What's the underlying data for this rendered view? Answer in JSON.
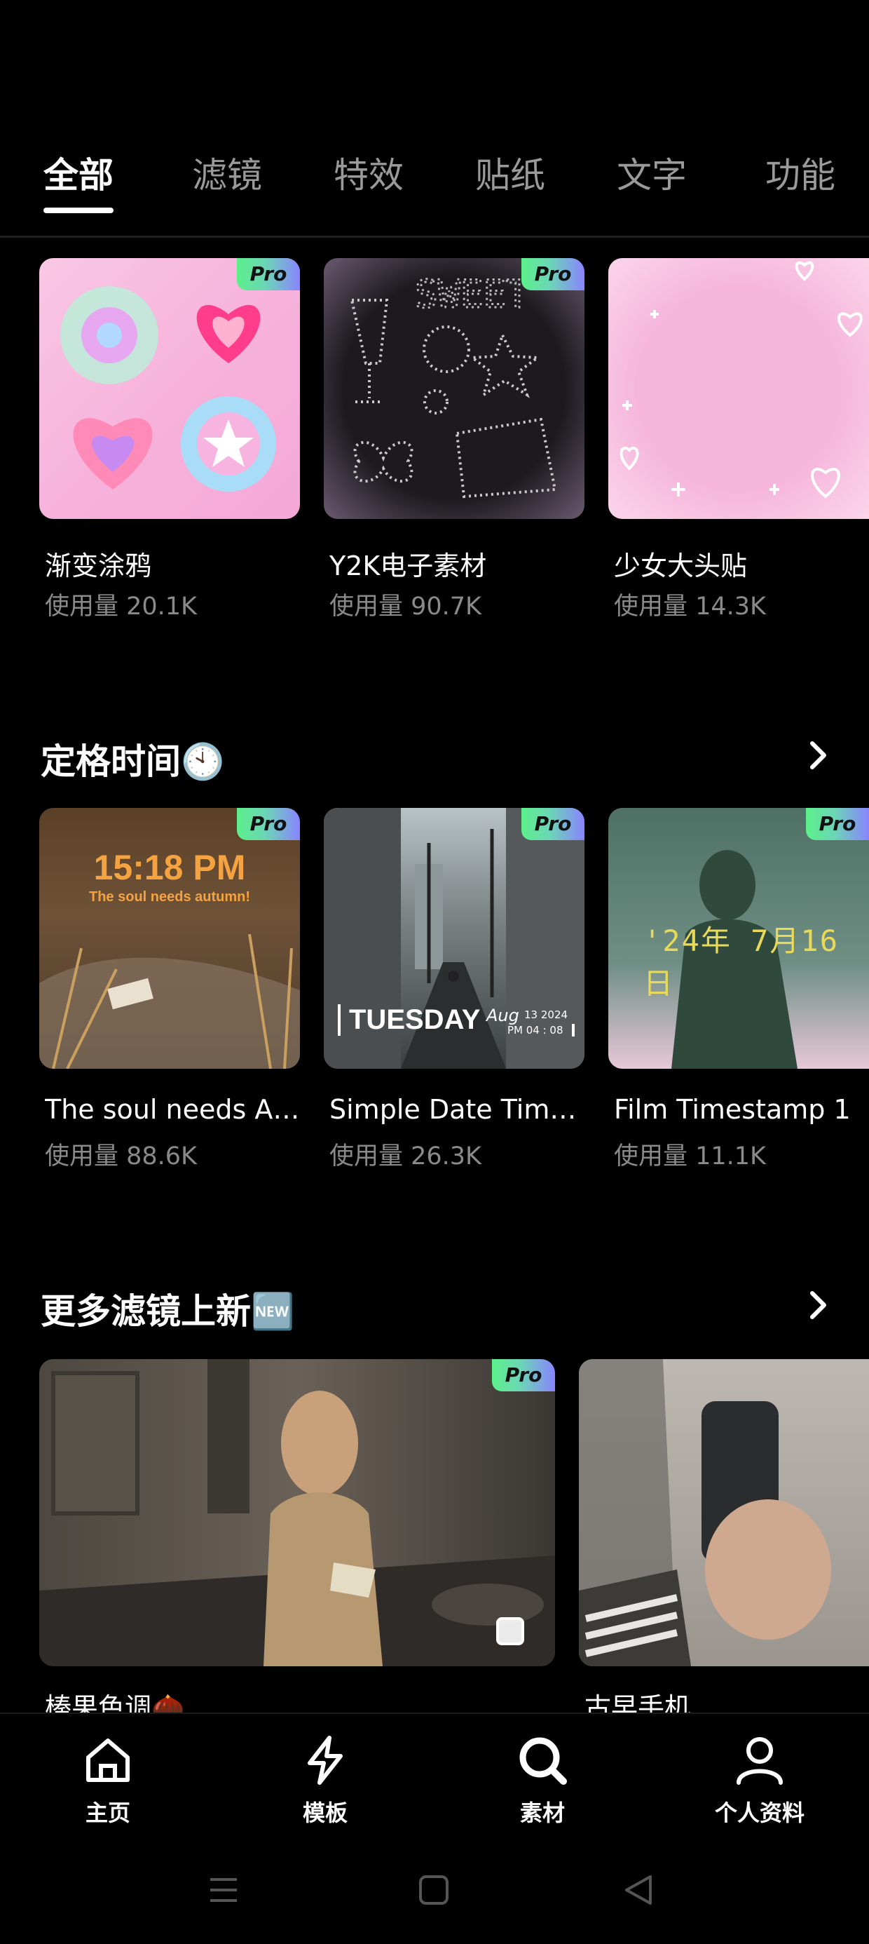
{
  "tabs": [
    "全部",
    "滤镜",
    "特效",
    "贴纸",
    "文字",
    "功能"
  ],
  "row1": [
    {
      "title": "渐变涂鸦",
      "usage": "使用量 20.1K",
      "pro": "Pro"
    },
    {
      "title": "Y2K电子素材",
      "usage": "使用量 90.7K",
      "pro": "Pro"
    },
    {
      "title": "少女大头贴",
      "usage": "使用量 14.3K",
      "pro": ""
    }
  ],
  "section2": {
    "title": "定格时间🕙"
  },
  "row2": [
    {
      "title": "The soul needs Aut...",
      "usage": "使用量 88.6K",
      "pro": "Pro",
      "overlay_time": "15:18 PM",
      "overlay_sub": "The soul needs autumn!"
    },
    {
      "title": "Simple Date Times...",
      "usage": "使用量 26.3K",
      "pro": "Pro",
      "overlay_day": "TUESDAY",
      "overlay_month": "Aug",
      "overlay_date": "13 2024",
      "overlay_clock": "PM 04 : 08"
    },
    {
      "title": "Film Timestamp 1",
      "usage": "使用量 11.1K",
      "pro": "Pro",
      "overlay_stamp": "'24年 7月16日"
    }
  ],
  "section3": {
    "title": "更多滤镜上新🆕"
  },
  "row3": [
    {
      "title": "榛果色调🌰",
      "pro": "Pro"
    },
    {
      "title": "古早手机"
    }
  ],
  "nav": [
    {
      "label": "主页",
      "icon": "home-icon"
    },
    {
      "label": "模板",
      "icon": "lightning-icon"
    },
    {
      "label": "素材",
      "icon": "search-icon"
    },
    {
      "label": "个人资料",
      "icon": "person-icon"
    }
  ],
  "colors": {
    "background": "#000000",
    "tab_inactive": "#9a9a9a",
    "usage_text": "#8a8a8a",
    "pro_gradient": [
      "#5cf08a",
      "#8a84ff"
    ]
  }
}
